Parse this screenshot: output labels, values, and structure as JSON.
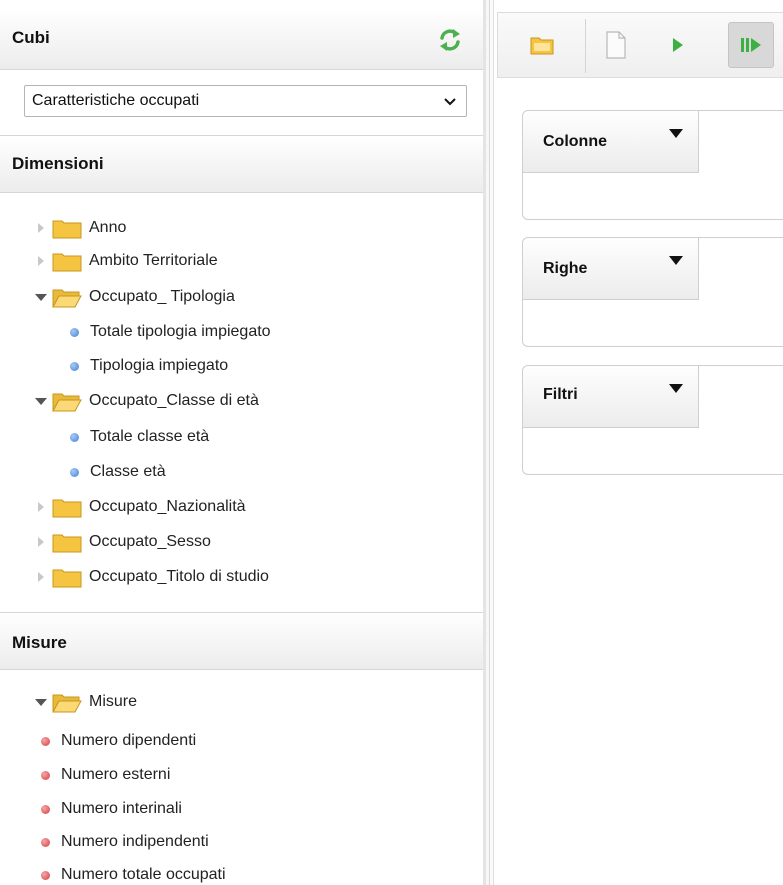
{
  "cubes": {
    "title": "Cubi",
    "selected_cube": "Caratteristiche occupati"
  },
  "dimensions": {
    "title": "Dimensioni",
    "items": [
      {
        "label": "Anno",
        "type": "folder",
        "expanded": false
      },
      {
        "label": "Ambito Territoriale",
        "type": "folder",
        "expanded": false
      },
      {
        "label": "Occupato_ Tipologia",
        "type": "folder",
        "expanded": true
      },
      {
        "label": "Totale tipologia impiegato",
        "type": "level"
      },
      {
        "label": "Tipologia impiegato",
        "type": "level"
      },
      {
        "label": "Occupato_Classe di età",
        "type": "folder",
        "expanded": true
      },
      {
        "label": "Totale classe età",
        "type": "level"
      },
      {
        "label": "Classe età",
        "type": "level"
      },
      {
        "label": "Occupato_Nazionalità",
        "type": "folder",
        "expanded": false
      },
      {
        "label": "Occupato_Sesso",
        "type": "folder",
        "expanded": false
      },
      {
        "label": "Occupato_Titolo di studio",
        "type": "folder",
        "expanded": false
      }
    ]
  },
  "measures": {
    "title": "Misure",
    "folder_label": "Misure",
    "items": [
      {
        "label": "Numero dipendenti"
      },
      {
        "label": "Numero esterni"
      },
      {
        "label": "Numero interinali"
      },
      {
        "label": "Numero indipendenti"
      },
      {
        "label": "Numero totale occupati"
      }
    ]
  },
  "query_panels": {
    "columns": "Colonne",
    "rows": "Righe",
    "filters": "Filtri"
  },
  "colors": {
    "refresh_green": "#4caf50",
    "folder_yellow": "#f5c542",
    "run_green": "#3cb043",
    "level_dot_blue": "#3f83d8",
    "measure_dot_red": "#d63b3b"
  },
  "icons": {
    "refresh": "refresh-icon",
    "folder_closed": "folder-icon",
    "folder_open": "folder-open-icon",
    "open_query": "open-folder-icon",
    "new_query": "new-document-icon",
    "run": "play-icon",
    "auto_run": "auto-run-icon"
  }
}
